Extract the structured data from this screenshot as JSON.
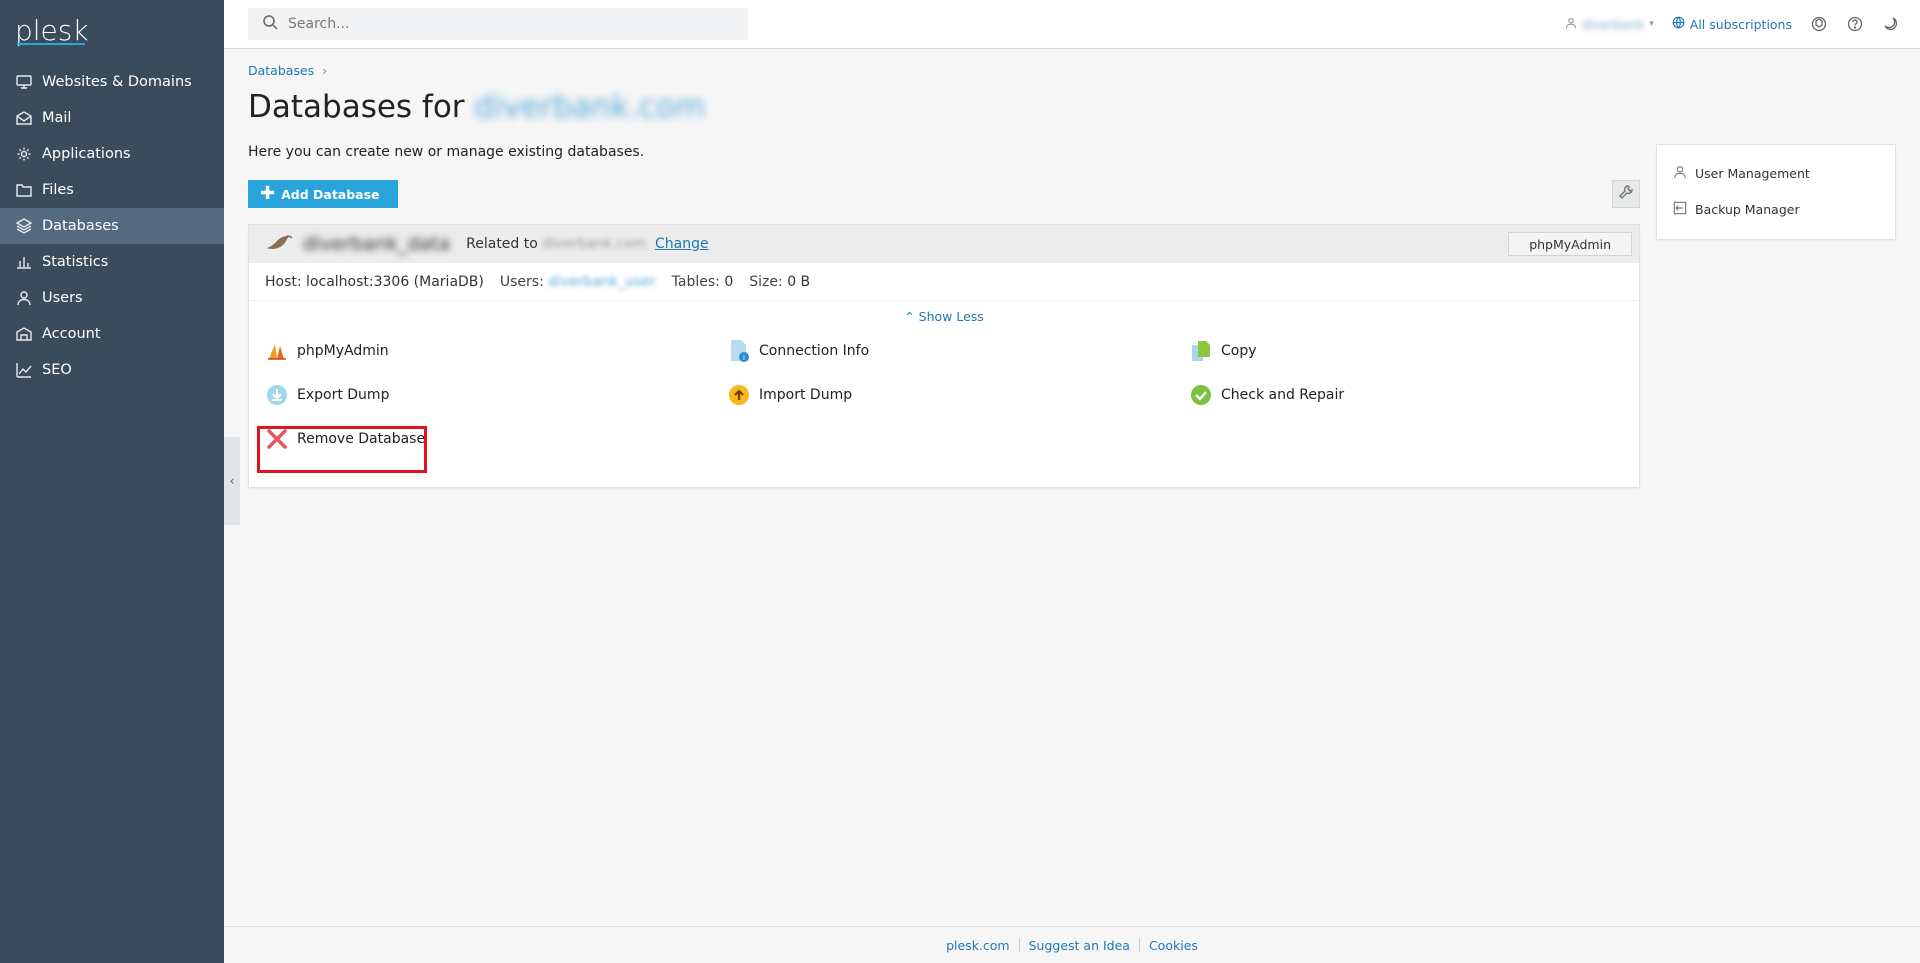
{
  "brand": {
    "logo": "plesk"
  },
  "sidebar": {
    "items": [
      {
        "label": "Websites & Domains",
        "icon": "monitor-icon"
      },
      {
        "label": "Mail",
        "icon": "mail-icon"
      },
      {
        "label": "Applications",
        "icon": "gear-icon"
      },
      {
        "label": "Files",
        "icon": "folder-icon"
      },
      {
        "label": "Databases",
        "icon": "layers-icon",
        "active": true
      },
      {
        "label": "Statistics",
        "icon": "bar-chart-icon"
      },
      {
        "label": "Users",
        "icon": "user-icon"
      },
      {
        "label": "Account",
        "icon": "account-icon"
      },
      {
        "label": "SEO",
        "icon": "seo-chart-icon"
      }
    ]
  },
  "topbar": {
    "search_placeholder": "Search...",
    "user_name": "diverbank",
    "subscriptions_label": "All subscriptions"
  },
  "breadcrumb": {
    "item": "Databases",
    "separator": "›"
  },
  "page": {
    "title_prefix": "Databases for",
    "title_domain": "diverbank.com",
    "description": "Here you can create new or manage existing databases.",
    "add_button": "Add Database"
  },
  "database": {
    "name": "diverbank_data",
    "related_prefix": "Related to",
    "related_domain": "diverbank.com",
    "change_label": "Change",
    "phpmyadmin_button": "phpMyAdmin",
    "host_label": "Host: localhost:3306 (MariaDB)",
    "users_label": "Users:",
    "users_value": "diverbank_user",
    "tables_label": "Tables:",
    "tables_value": "0",
    "size_label": "Size:",
    "size_value": "0 B",
    "show_less": "Show Less",
    "actions": [
      {
        "label": "phpMyAdmin",
        "icon": "phpmyadmin-icon"
      },
      {
        "label": "Connection Info",
        "icon": "connection-info-icon"
      },
      {
        "label": "Copy",
        "icon": "copy-icon"
      },
      {
        "label": "Export Dump",
        "icon": "export-dump-icon"
      },
      {
        "label": "Import Dump",
        "icon": "import-dump-icon"
      },
      {
        "label": "Check and Repair",
        "icon": "check-repair-icon"
      },
      {
        "label": "Remove Database",
        "icon": "remove-icon"
      }
    ]
  },
  "side_panel": {
    "items": [
      {
        "label": "User Management",
        "icon": "user-icon"
      },
      {
        "label": "Backup Manager",
        "icon": "backup-icon"
      }
    ]
  },
  "footer": {
    "links": [
      "plesk.com",
      "Suggest an Idea",
      "Cookies"
    ]
  },
  "colors": {
    "sidebar_bg": "#3a4b5c",
    "sidebar_active": "#566a7f",
    "accent": "#28a3dc",
    "link": "#1e78b4",
    "highlight_border": "#e0141e"
  }
}
